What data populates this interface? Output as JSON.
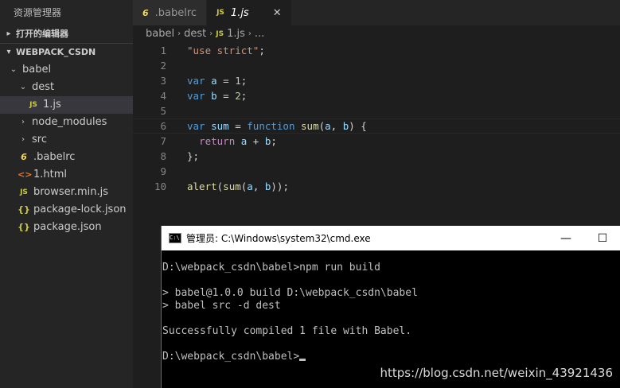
{
  "sidebar": {
    "title": "资源管理器",
    "open_editors_label": "打开的编辑器",
    "workspace_label": "WEBPACK_CSDN",
    "tree": [
      {
        "label": "babel",
        "kind": "folder-open"
      },
      {
        "label": "dest",
        "kind": "folder-open"
      },
      {
        "label": "1.js",
        "kind": "js",
        "icon": "JS",
        "selected": true
      },
      {
        "label": "node_modules",
        "kind": "folder-closed"
      },
      {
        "label": "src",
        "kind": "folder-closed"
      },
      {
        "label": ".babelrc",
        "kind": "babel",
        "icon": "6"
      },
      {
        "label": "1.html",
        "kind": "html",
        "icon": "<>"
      },
      {
        "label": "browser.min.js",
        "kind": "js",
        "icon": "JS"
      },
      {
        "label": "package-lock.json",
        "kind": "json",
        "icon": "{}"
      },
      {
        "label": "package.json",
        "kind": "json",
        "icon": "{}"
      }
    ]
  },
  "tabs": [
    {
      "label": ".babelrc",
      "icon": "6",
      "active": false
    },
    {
      "label": "1.js",
      "icon": "JS",
      "active": true,
      "close": "✕"
    }
  ],
  "breadcrumb": [
    "babel",
    "dest",
    "1.js",
    "..."
  ],
  "editor": {
    "lines": [
      {
        "n": "1",
        "code": "\"use strict\";"
      },
      {
        "n": "2",
        "code": ""
      },
      {
        "n": "3",
        "code": "var a = 1;"
      },
      {
        "n": "4",
        "code": "var b = 2;"
      },
      {
        "n": "5",
        "code": ""
      },
      {
        "n": "6",
        "code": "var sum = function sum(a, b) {"
      },
      {
        "n": "7",
        "code": "  return a + b;"
      },
      {
        "n": "8",
        "code": "};"
      },
      {
        "n": "9",
        "code": ""
      },
      {
        "n": "10",
        "code": "alert(sum(a, b));"
      }
    ]
  },
  "cmd": {
    "title": "管理员: C:\\Windows\\system32\\cmd.exe",
    "minimize": "—",
    "maximize": "☐",
    "lines": [
      "D:\\webpack_csdn\\babel>npm run build",
      "",
      "> babel@1.0.0 build D:\\webpack_csdn\\babel",
      "> babel src -d dest",
      "",
      "Successfully compiled 1 file with Babel.",
      "",
      "D:\\webpack_csdn\\babel>"
    ]
  },
  "watermark": "https://blog.csdn.net/weixin_43921436"
}
